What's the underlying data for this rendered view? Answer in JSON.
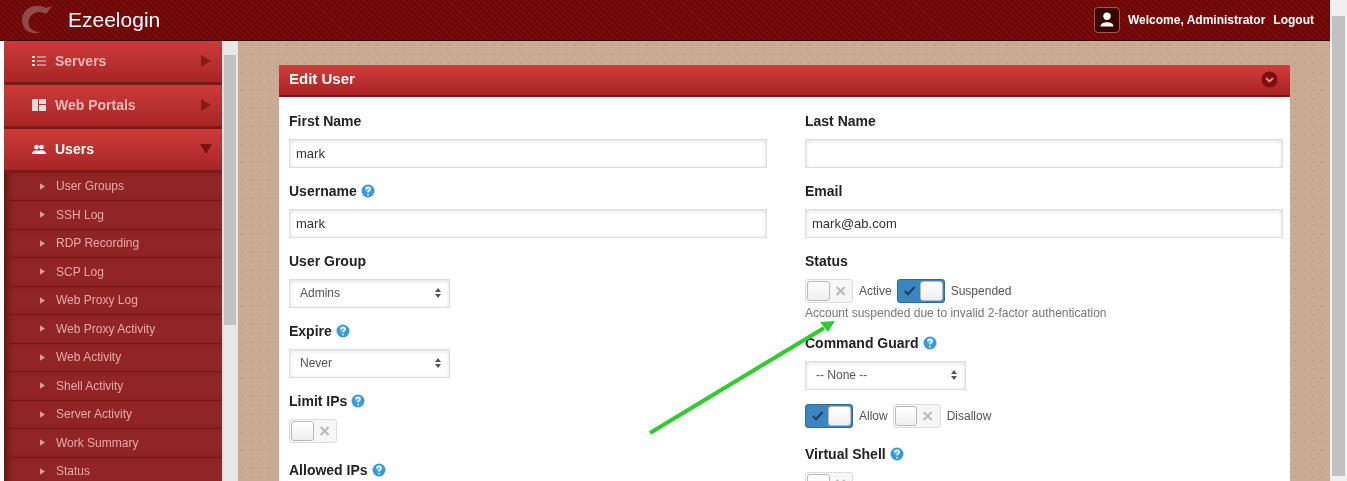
{
  "header": {
    "brand": "Ezeelogin",
    "welcome": "Welcome, Administrator",
    "logout": "Logout"
  },
  "sidebar": {
    "items": [
      {
        "label": "Servers",
        "expanded": false
      },
      {
        "label": "Web Portals",
        "expanded": false
      },
      {
        "label": "Users",
        "expanded": true,
        "children": [
          {
            "label": "User Groups"
          },
          {
            "label": "SSH Log"
          },
          {
            "label": "RDP Recording"
          },
          {
            "label": "SCP Log"
          },
          {
            "label": "Web Proxy Log"
          },
          {
            "label": "Web Proxy Activity"
          },
          {
            "label": "Web Activity"
          },
          {
            "label": "Shell Activity"
          },
          {
            "label": "Server Activity"
          },
          {
            "label": "Work Summary"
          },
          {
            "label": "Status"
          }
        ]
      }
    ]
  },
  "panel": {
    "title": "Edit User",
    "left": [
      {
        "kind": "text",
        "label": "First Name",
        "help": false,
        "value": "mark"
      },
      {
        "kind": "text",
        "label": "Username",
        "help": true,
        "value": "mark"
      },
      {
        "kind": "select",
        "label": "User Group",
        "help": false,
        "value": "Admins"
      },
      {
        "kind": "select",
        "label": "Expire",
        "help": true,
        "value": "Never"
      },
      {
        "kind": "toggle",
        "label": "Limit IPs",
        "help": true,
        "on": false
      },
      {
        "kind": "heading",
        "label": "Allowed IPs",
        "help": true
      }
    ],
    "right": [
      {
        "kind": "text",
        "label": "Last Name",
        "help": false
      },
      {
        "kind": "text",
        "label": "Email",
        "help": false,
        "value": "mark@ab.com"
      },
      {
        "kind": "choice",
        "label": "Status",
        "help": false,
        "options": [
          {
            "label": "Active",
            "selected": false
          },
          {
            "label": "Suspended",
            "selected": true
          }
        ],
        "note": "Account suspended due to invalid 2-factor authentication"
      },
      {
        "kind": "select",
        "label": "Command Guard",
        "help": true,
        "value": "-- None --"
      },
      {
        "kind": "choice",
        "options": [
          {
            "label": "Allow",
            "selected": true
          },
          {
            "label": "Disallow",
            "selected": false
          }
        ]
      },
      {
        "kind": "toggle",
        "label": "Virtual Shell",
        "help": true,
        "on": false
      }
    ]
  }
}
